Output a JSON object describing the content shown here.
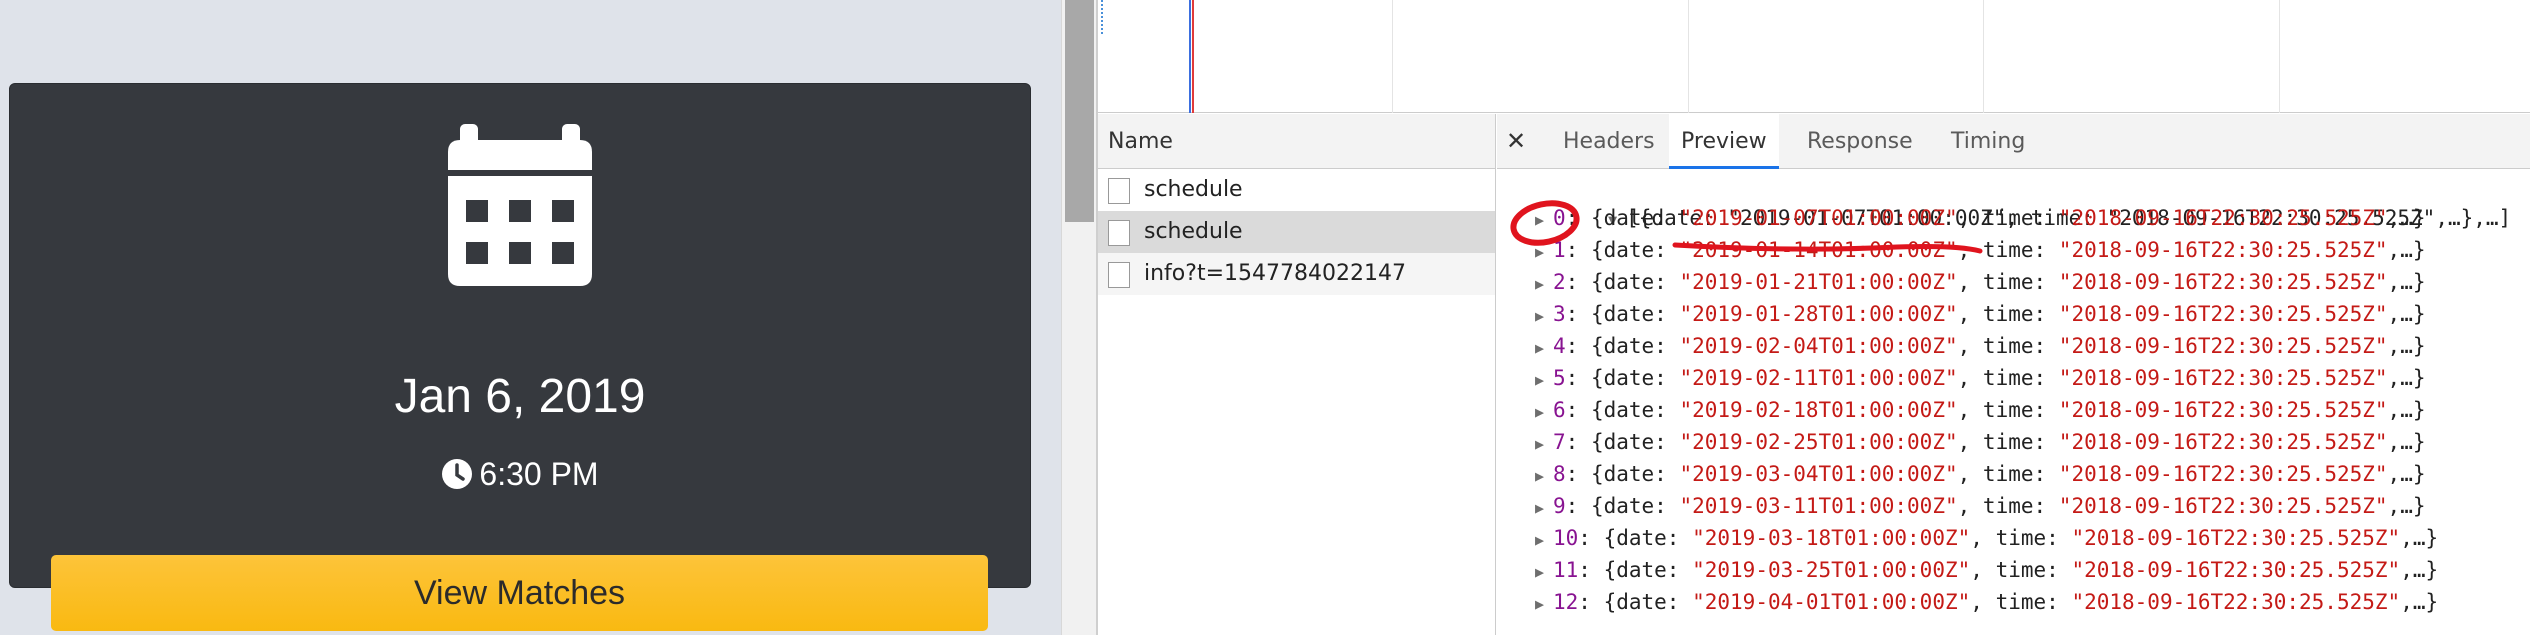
{
  "event": {
    "date": "Jan 6, 2019",
    "time": "6:30 PM",
    "view_matches_label": "View Matches",
    "colors": {
      "card": "#36393e",
      "button": "#fdc43a",
      "background": "#dfe3ea"
    }
  },
  "network": {
    "list_header": "Name",
    "requests": [
      {
        "name": "schedule"
      },
      {
        "name": "schedule"
      },
      {
        "name": "info?t=1547784022147"
      }
    ]
  },
  "detail": {
    "close_label": "✕",
    "tabs": [
      {
        "label": "Headers"
      },
      {
        "label": "Preview"
      },
      {
        "label": "Response"
      },
      {
        "label": "Timing"
      }
    ],
    "active_tab": "Preview",
    "summary": "[{date: \"2019-01-07T01:00:00Z\", time: \"2018-09-16T22:30:25.525Z\",…},…]",
    "items": [
      {
        "index": "0",
        "date": "2019-01-07T01:00:00Z",
        "time": "2018-09-16T22:30:25.525Z"
      },
      {
        "index": "1",
        "date": "2019-01-14T01:00:00Z",
        "time": "2018-09-16T22:30:25.525Z"
      },
      {
        "index": "2",
        "date": "2019-01-21T01:00:00Z",
        "time": "2018-09-16T22:30:25.525Z"
      },
      {
        "index": "3",
        "date": "2019-01-28T01:00:00Z",
        "time": "2018-09-16T22:30:25.525Z"
      },
      {
        "index": "4",
        "date": "2019-02-04T01:00:00Z",
        "time": "2018-09-16T22:30:25.525Z"
      },
      {
        "index": "5",
        "date": "2019-02-11T01:00:00Z",
        "time": "2018-09-16T22:30:25.525Z"
      },
      {
        "index": "6",
        "date": "2019-02-18T01:00:00Z",
        "time": "2018-09-16T22:30:25.525Z"
      },
      {
        "index": "7",
        "date": "2019-02-25T01:00:00Z",
        "time": "2018-09-16T22:30:25.525Z"
      },
      {
        "index": "8",
        "date": "2019-03-04T01:00:00Z",
        "time": "2018-09-16T22:30:25.525Z"
      },
      {
        "index": "9",
        "date": "2019-03-11T01:00:00Z",
        "time": "2018-09-16T22:30:25.525Z"
      },
      {
        "index": "10",
        "date": "2019-03-18T01:00:00Z",
        "time": "2018-09-16T22:30:25.525Z"
      },
      {
        "index": "11",
        "date": "2019-03-25T01:00:00Z",
        "time": "2018-09-16T22:30:25.525Z"
      },
      {
        "index": "12",
        "date": "2019-04-01T01:00:00Z",
        "time": "2018-09-16T22:30:25.525Z"
      }
    ],
    "annotation_color": "#e0141e"
  }
}
